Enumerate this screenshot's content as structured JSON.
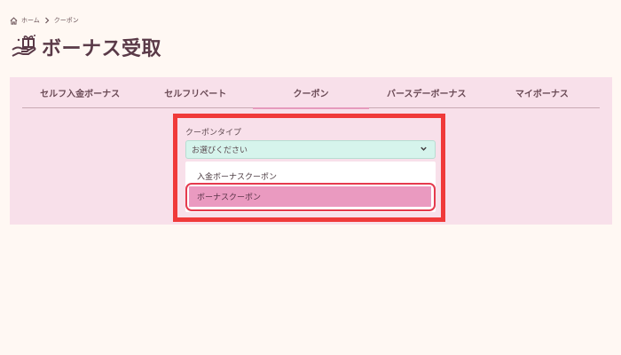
{
  "breadcrumb": {
    "home_icon": "home-icon",
    "home_label": "ホーム",
    "separator_icon": "chevron-right-icon",
    "current_label": "クーポン"
  },
  "title": {
    "icon": "gift-hand-icon",
    "text": "ボーナス受取"
  },
  "tabs": [
    {
      "label": "セルフ入金ボーナス",
      "active": false
    },
    {
      "label": "セルフリベート",
      "active": false
    },
    {
      "label": "クーポン",
      "active": true
    },
    {
      "label": "バースデーボーナス",
      "active": false
    },
    {
      "label": "マイボーナス",
      "active": false
    }
  ],
  "coupon_type": {
    "label": "クーポンタイプ",
    "selected": "お選びください",
    "chevron_icon": "chevron-down-icon",
    "options": [
      {
        "label": "入金ボーナスクーポン",
        "highlighted": false
      },
      {
        "label": "ボーナスクーポン",
        "highlighted": true
      }
    ]
  },
  "colors": {
    "accent_pink": "#ea9ac0",
    "panel_bg": "#f8e0ea",
    "select_bg": "#d6f4ec",
    "highlight_red": "#f03a3a",
    "page_bg": "#fff8f3",
    "title_color": "#5a3a48"
  }
}
